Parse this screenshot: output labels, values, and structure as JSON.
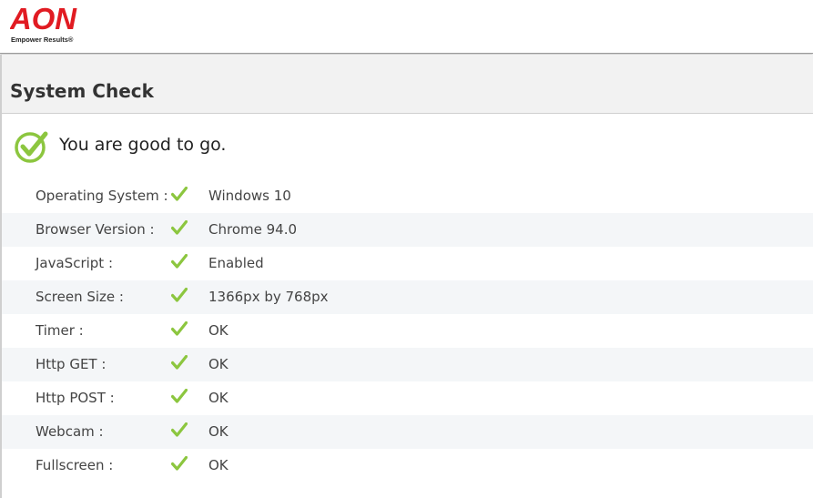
{
  "header": {
    "logo_text": "AON",
    "tagline": "Empower Results®",
    "brand_color": "#e11b22"
  },
  "page": {
    "title": "System Check"
  },
  "status": {
    "message": "You are good to go.",
    "icon": "check-circle-icon",
    "color": "#8cc63f"
  },
  "checks": [
    {
      "label": "Operating System :",
      "value": "Windows 10",
      "icon": "check-icon"
    },
    {
      "label": "Browser Version :",
      "value": "Chrome 94.0",
      "icon": "check-icon"
    },
    {
      "label": "JavaScript :",
      "value": "Enabled",
      "icon": "check-icon"
    },
    {
      "label": "Screen Size :",
      "value": "1366px by 768px",
      "icon": "check-icon"
    },
    {
      "label": "Timer :",
      "value": "OK",
      "icon": "check-icon"
    },
    {
      "label": "Http GET :",
      "value": "OK",
      "icon": "check-icon"
    },
    {
      "label": "Http POST :",
      "value": "OK",
      "icon": "check-icon"
    },
    {
      "label": "Webcam :",
      "value": "OK",
      "icon": "check-icon"
    },
    {
      "label": "Fullscreen :",
      "value": "OK",
      "icon": "check-icon"
    }
  ]
}
